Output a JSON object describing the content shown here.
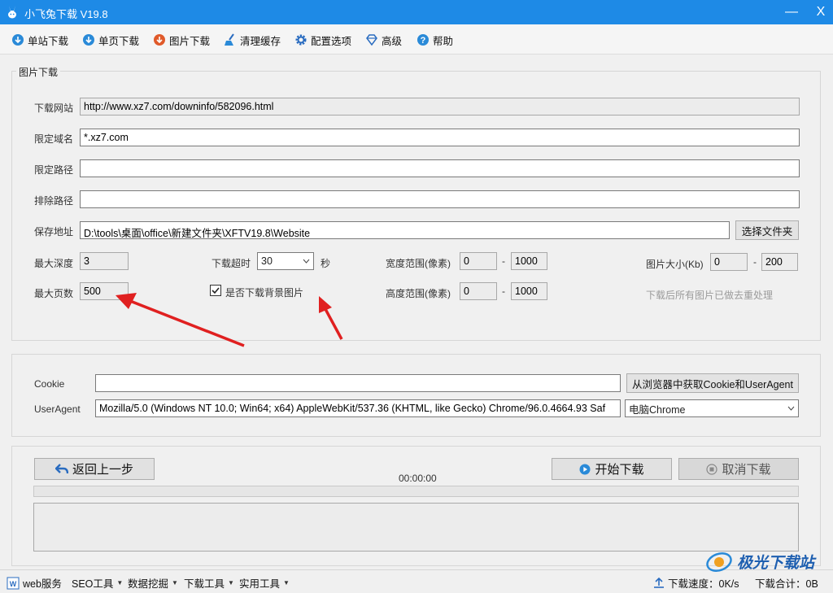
{
  "window": {
    "title": "小飞兔下载 V19.8",
    "minimize": "—",
    "close": "X"
  },
  "toolbar": {
    "items": [
      {
        "label": "单站下载",
        "icon": "download-circle-icon"
      },
      {
        "label": "单页下载",
        "icon": "download-circle-icon"
      },
      {
        "label": "图片下载",
        "icon": "download-circle-icon"
      },
      {
        "label": "清理缓存",
        "icon": "broom-icon"
      },
      {
        "label": "配置选项",
        "icon": "gear-icon"
      },
      {
        "label": "高级",
        "icon": "diamond-icon"
      },
      {
        "label": "帮助",
        "icon": "help-circle-icon"
      }
    ]
  },
  "image_download": {
    "legend": "图片下载",
    "url_label": "下载网站",
    "url_value": "http://www.xz7.com/downinfo/582096.html",
    "domain_label": "限定域名",
    "domain_value": "*.xz7.com",
    "path_label": "限定路径",
    "path_value": "",
    "exclude_label": "排除路径",
    "exclude_value": "",
    "save_label": "保存地址",
    "save_value": "D:\\tools\\桌面\\office\\新建文件夹\\XFTV19.8\\Website",
    "choose_folder": "选择文件夹",
    "max_depth_label": "最大深度",
    "max_depth_value": "3",
    "max_pages_label": "最大页数",
    "max_pages_value": "500",
    "timeout_label": "下载超时",
    "timeout_value": "30",
    "timeout_unit": "秒",
    "bg_checkbox_label": "是否下载背景图片",
    "bg_checked": true,
    "width_label": "宽度范围(像素)",
    "width_min": "0",
    "width_max": "1000",
    "height_label": "高度范围(像素)",
    "height_min": "0",
    "height_max": "1000",
    "size_label": "图片大小(Kb)",
    "size_min": "0",
    "size_max": "200",
    "dash": "-",
    "dedupe_hint": "下载后所有图片已做去重处理"
  },
  "request": {
    "cookie_label": "Cookie",
    "cookie_value": "",
    "get_cookie_button": "从浏览器中获取Cookie和UserAgent",
    "ua_label": "UserAgent",
    "ua_value": "Mozilla/5.0 (Windows NT 10.0; Win64; x64) AppleWebKit/537.36 (KHTML, like Gecko) Chrome/96.0.4664.93 Saf",
    "ua_preset": "电脑Chrome"
  },
  "progress": {
    "back_button": "返回上一步",
    "timer": "00:00:00",
    "start_button": "开始下载",
    "cancel_button": "取消下载",
    "percent": 0
  },
  "statusbar": {
    "items": [
      "web服务",
      "SEO工具",
      "数据挖掘",
      "下载工具",
      "实用工具"
    ],
    "speed_label": "下载速度：0K/s",
    "total_label": "下载合计：0B"
  },
  "watermark": "极光下载站",
  "colors": {
    "titlebar": "#1e8ae6",
    "window_bg": "#f0f0f0",
    "arrow": "#e02020"
  }
}
